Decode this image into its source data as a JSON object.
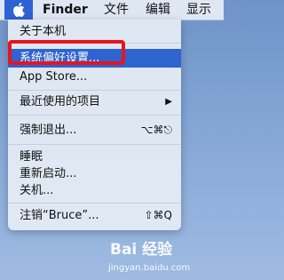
{
  "menubar": {
    "apple_icon": "apple-icon",
    "app_name": "Finder",
    "items": [
      "文件",
      "编辑",
      "显示"
    ]
  },
  "apple_menu": {
    "items": [
      {
        "label": "关于本机"
      },
      {
        "label": "系统偏好设置...",
        "selected": true
      },
      {
        "label": "App Store..."
      },
      {
        "label": "最近使用的项目",
        "submenu_icon": "chevron-right-icon"
      },
      {
        "label": "强制退出...",
        "shortcut": "⌥⌘⎋"
      },
      {
        "label": "睡眠"
      },
      {
        "label": "重新启动..."
      },
      {
        "label": "关机..."
      },
      {
        "label": "注销“Bruce”...",
        "shortcut": "⇧⌘Q"
      }
    ]
  },
  "watermark": {
    "brand": "Bai 经验",
    "url": "jingyan.baidu.com"
  },
  "colors": {
    "accent": "#2e64cf",
    "highlight": "#e8141c",
    "desktop": "#84a6d6"
  }
}
